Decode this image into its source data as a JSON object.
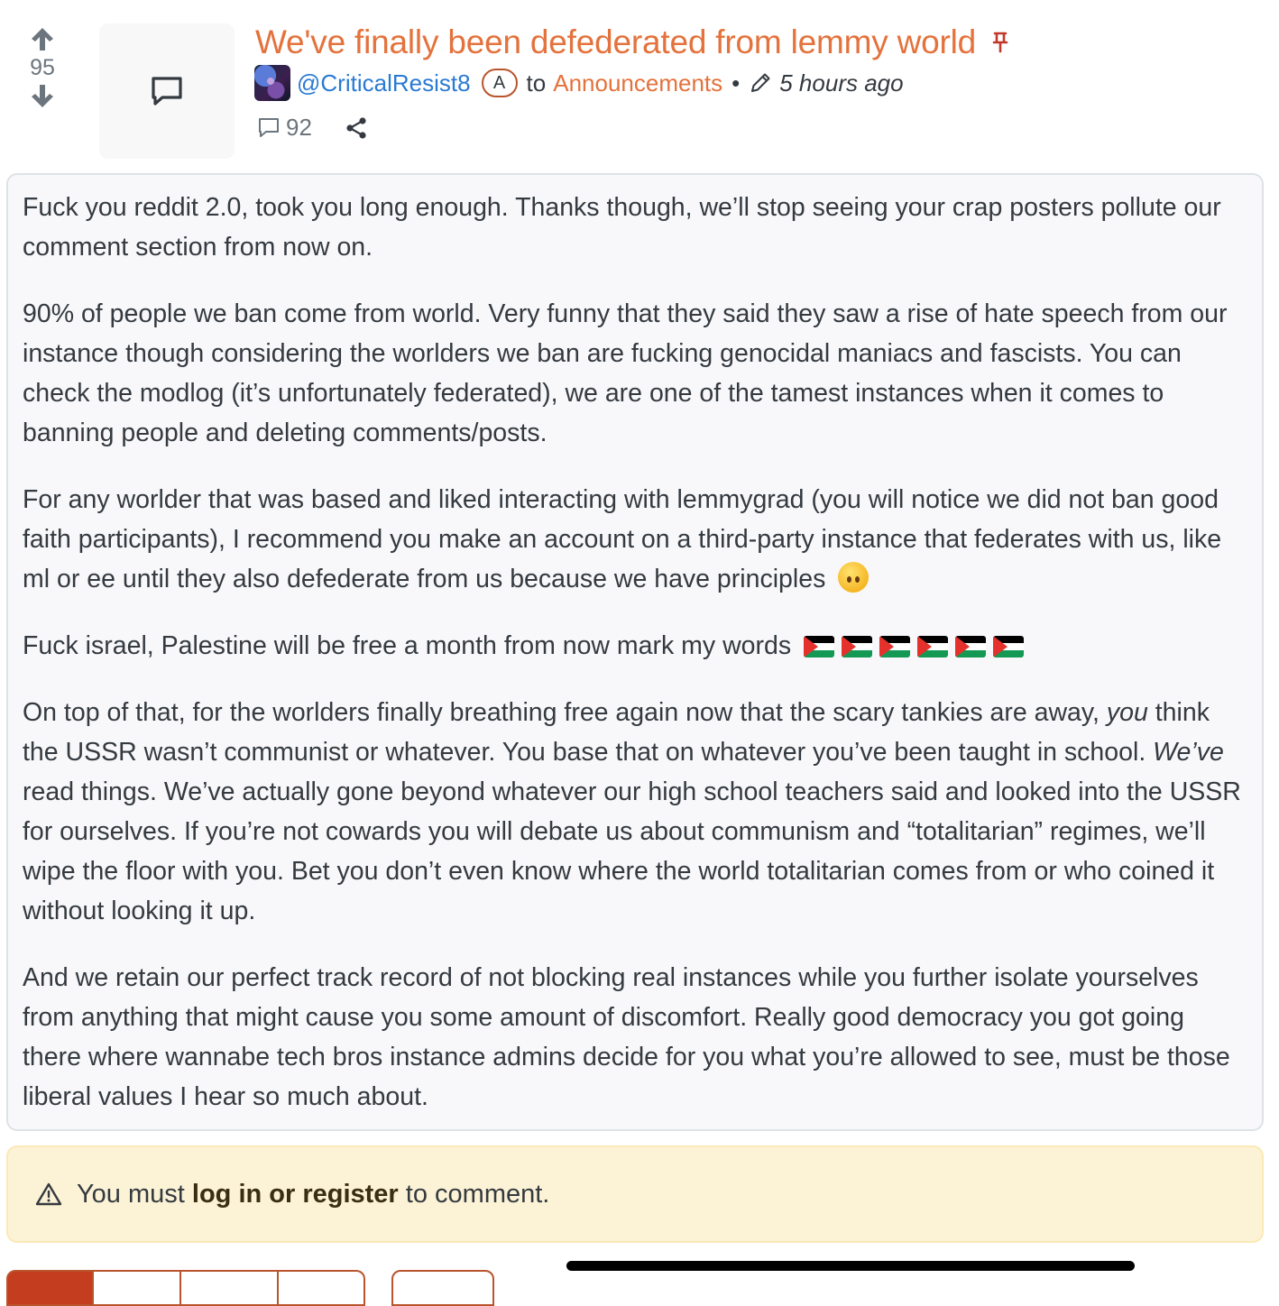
{
  "post": {
    "score": "95",
    "title": "We've finally been defederated from lemmy world",
    "author": "@CriticalResist8",
    "author_badge": "A",
    "to_label": "to",
    "community": "Announcements",
    "separator": "•",
    "time": "5 hours ago",
    "comment_count": "92"
  },
  "body": {
    "p1": "Fuck you reddit 2.0, took you long enough. Thanks though, we’ll stop seeing your crap posters pollute our comment section from now on.",
    "p2": "90% of people we ban come from world. Very funny that they said they saw a rise of hate speech from our instance though considering the worlders we ban are fucking genocidal maniacs and fascists. You can check the modlog (it’s unfortunately federated), we are one of the tamest instances when it comes to banning people and deleting comments/posts.",
    "p3": "For any worlder that was based and liked interacting with lemmygrad (you will notice we did not ban good faith participants), I recommend you make an account on a third-party instance that federates with us, like ml or ee until they also defederate from us because we have principles",
    "p4": "Fuck israel, Palestine will be free a month from now mark my words",
    "p5_a": "On top of that, for the worlders finally breathing free again now that the scary tankies are away, ",
    "p5_em1": "you",
    "p5_b": " think the USSR wasn’t communist or whatever. You base that on whatever you’ve been taught in school. ",
    "p5_em2": "We’ve",
    "p5_c": " read things. We’ve actually gone beyond whatever our high school teachers said and looked into the USSR for ourselves. If you’re not cowards you will debate us about communism and “totalitarian” regimes, we’ll wipe the floor with you. Bet you don’t even know where the world totalitarian comes from or who coined it without looking it up.",
    "p6": "And we retain our perfect track record of not blocking real instances while you further isolate yourselves from anything that might cause you some amount of discomfort. Really good democracy you got going there where wannabe tech bros instance admins decide for you what you’re allowed to see, must be those liberal values I hear so much about.",
    "emoji": "upside-down-face",
    "flag_count": 6
  },
  "alert": {
    "prefix": "You must",
    "link": "log in or register",
    "suffix": "to comment."
  },
  "colors": {
    "accent": "#e4723c",
    "link": "#2a7ad3",
    "pin": "#c0392b",
    "alert_bg": "#fcf3d6",
    "button": "#c43d1f"
  },
  "icons": [
    "arrow-up-icon",
    "arrow-down-icon",
    "comment-icon",
    "pin-icon",
    "pencil-icon",
    "share-icon",
    "warning-icon"
  ]
}
